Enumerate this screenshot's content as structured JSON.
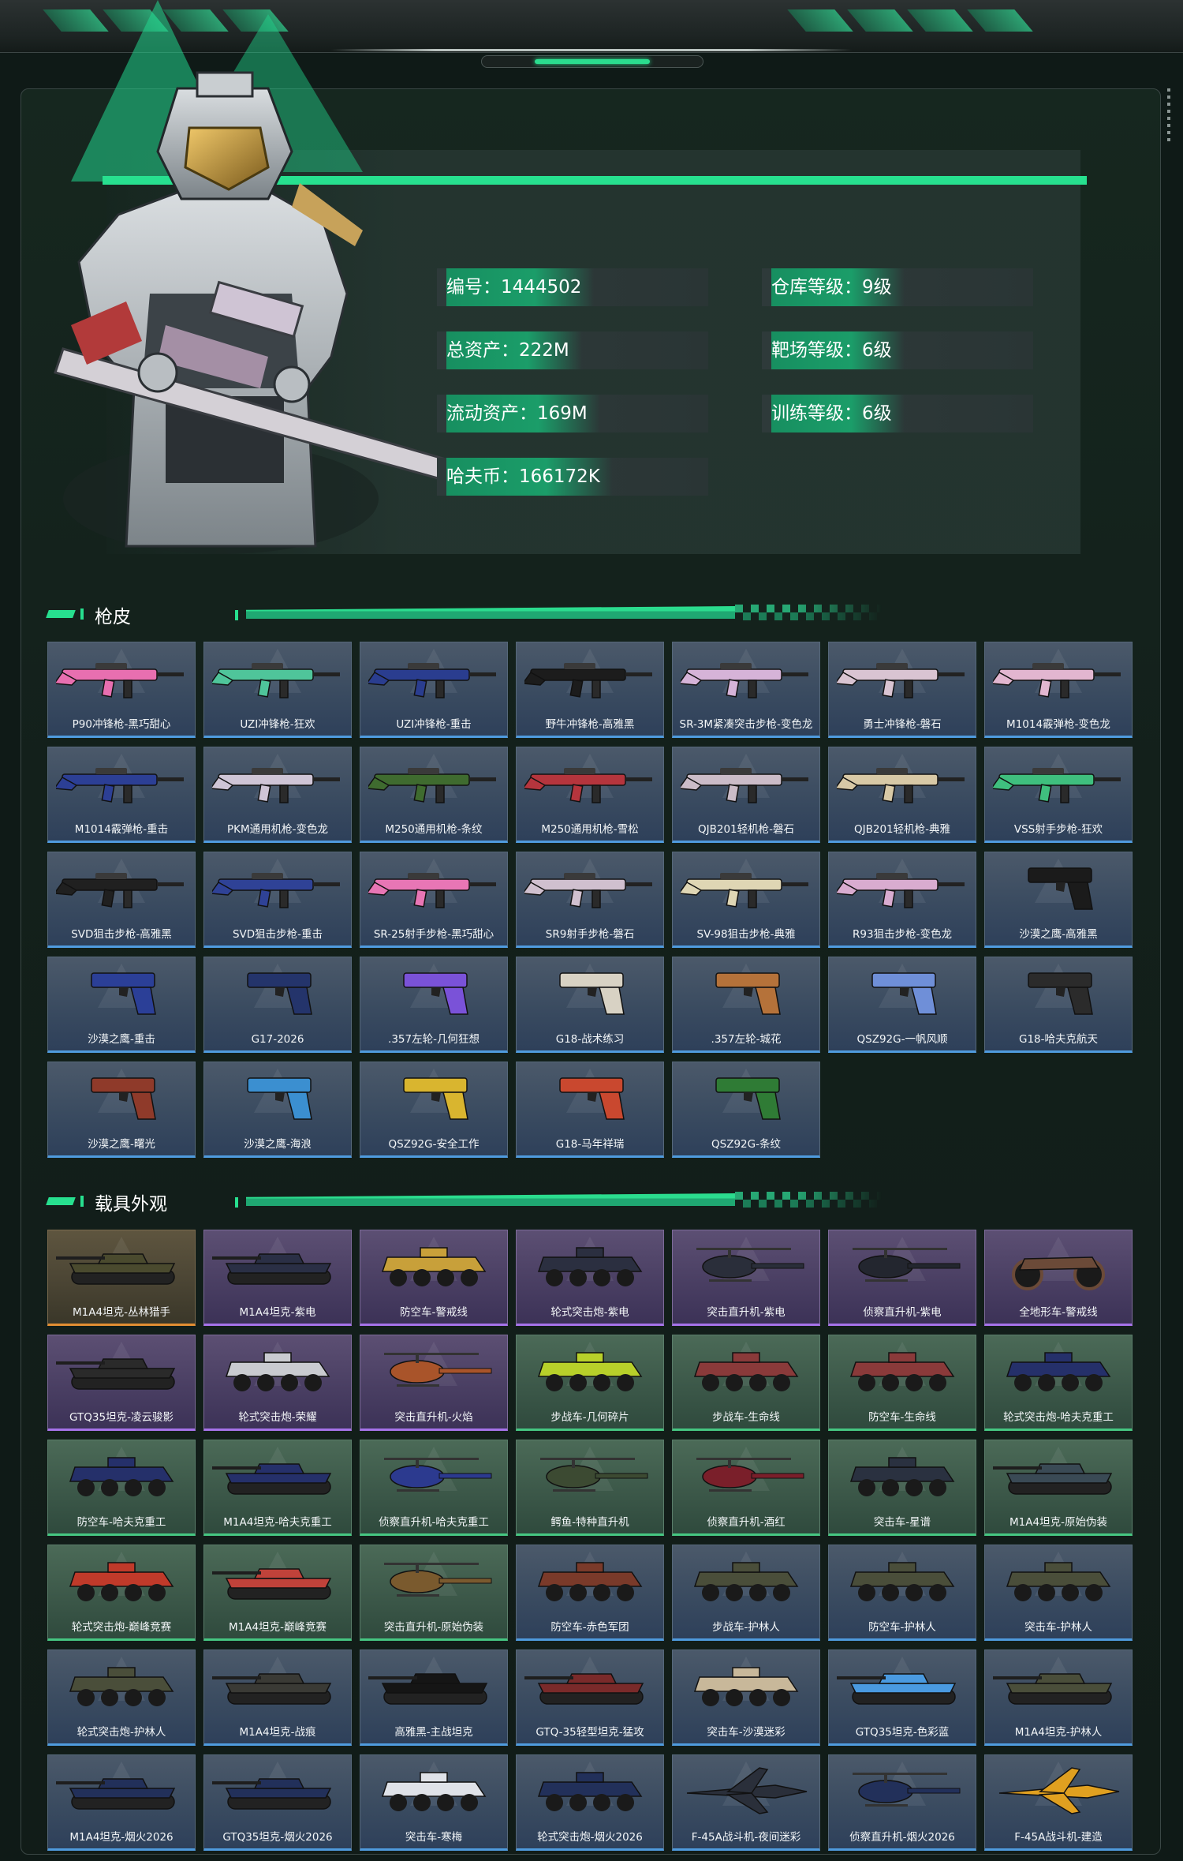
{
  "profile": {
    "stats": [
      {
        "label": "编号：",
        "value": "1444502"
      },
      {
        "label": "仓库等级：",
        "value": "9级"
      },
      {
        "label": "总资产：",
        "value": "222M"
      },
      {
        "label": "靶场等级：",
        "value": "6级"
      },
      {
        "label": "流动资产：",
        "value": "169M"
      },
      {
        "label": "训练等级：",
        "value": "6级"
      },
      {
        "label": "哈夫币：",
        "value": "166172K"
      }
    ]
  },
  "sections": {
    "gun_skins": {
      "title": "枪皮",
      "items": [
        {
          "name": "P90冲锋枪-黑巧甜心",
          "icon": "gun-icon",
          "color": "#e86fb0",
          "rarity": "blue"
        },
        {
          "name": "UZI冲锋枪-狂欢",
          "icon": "gun-icon",
          "color": "#4fc59a",
          "rarity": "blue"
        },
        {
          "name": "UZI冲锋枪-重击",
          "icon": "gun-icon",
          "color": "#2a3d8f",
          "rarity": "blue"
        },
        {
          "name": "野牛冲锋枪-高雅黑",
          "icon": "gun-icon",
          "color": "#1c1c1c",
          "rarity": "blue"
        },
        {
          "name": "SR-3M紧凑突击步枪-变色龙",
          "icon": "gun-icon",
          "color": "#d6b3d8",
          "rarity": "blue"
        },
        {
          "name": "勇士冲锋枪-磐石",
          "icon": "gun-icon",
          "color": "#d9c4d2",
          "rarity": "blue"
        },
        {
          "name": "M1014霰弹枪-变色龙",
          "icon": "gun-icon",
          "color": "#e2b6d0",
          "rarity": "blue"
        },
        {
          "name": "M1014霰弹枪-重击",
          "icon": "gun-icon",
          "color": "#2c3f95",
          "rarity": "blue"
        },
        {
          "name": "PKM通用机枪-变色龙",
          "icon": "gun-icon",
          "color": "#cfc5d6",
          "rarity": "blue"
        },
        {
          "name": "M250通用机枪-条纹",
          "icon": "gun-icon",
          "color": "#3f6b2f",
          "rarity": "blue"
        },
        {
          "name": "M250通用机枪-雪松",
          "icon": "gun-icon",
          "color": "#b5353d",
          "rarity": "blue"
        },
        {
          "name": "QJB201轻机枪-磐石",
          "icon": "gun-icon",
          "color": "#cbbcc8",
          "rarity": "blue"
        },
        {
          "name": "QJB201轻机枪-典雅",
          "icon": "gun-icon",
          "color": "#d8c9a6",
          "rarity": "blue"
        },
        {
          "name": "VSS射手步枪-狂欢",
          "icon": "gun-icon",
          "color": "#3fbf7e",
          "rarity": "blue"
        },
        {
          "name": "SVD狙击步枪-高雅黑",
          "icon": "gun-icon",
          "color": "#202020",
          "rarity": "blue"
        },
        {
          "name": "SVD狙击步枪-重击",
          "icon": "gun-icon",
          "color": "#2f4296",
          "rarity": "blue"
        },
        {
          "name": "SR-25射手步枪-黑巧甜心",
          "icon": "gun-icon",
          "color": "#e876b5",
          "rarity": "blue"
        },
        {
          "name": "SR9射手步枪-磐石",
          "icon": "gun-icon",
          "color": "#d0c0cf",
          "rarity": "blue"
        },
        {
          "name": "SV-98狙击步枪-典雅",
          "icon": "gun-icon",
          "color": "#dfd6b4",
          "rarity": "blue"
        },
        {
          "name": "R93狙击步枪-变色龙",
          "icon": "gun-icon",
          "color": "#d9acd0",
          "rarity": "blue"
        },
        {
          "name": "沙漠之鹰-高雅黑",
          "icon": "pistol-icon",
          "color": "#1b1b1b",
          "rarity": "blue"
        },
        {
          "name": "沙漠之鹰-重击",
          "icon": "pistol-icon",
          "color": "#2b3f97",
          "rarity": "blue"
        },
        {
          "name": "G17-2026",
          "icon": "pistol-icon",
          "color": "#24346b",
          "rarity": "blue"
        },
        {
          "name": ".357左轮-几何狂想",
          "icon": "pistol-icon",
          "color": "#7a52d8",
          "rarity": "blue"
        },
        {
          "name": "G18-战术练习",
          "icon": "pistol-icon",
          "color": "#d8d2c4",
          "rarity": "blue"
        },
        {
          "name": ".357左轮-城花",
          "icon": "pistol-icon",
          "color": "#b5723a",
          "rarity": "blue"
        },
        {
          "name": "QSZ92G-一帆风顺",
          "icon": "pistol-icon",
          "color": "#6f8fd8",
          "rarity": "blue"
        },
        {
          "name": "G18-哈夫克航天",
          "icon": "pistol-icon",
          "color": "#2b2b2b",
          "rarity": "blue"
        },
        {
          "name": "沙漠之鹰-曙光",
          "icon": "pistol-icon",
          "color": "#8f3a2a",
          "rarity": "blue"
        },
        {
          "name": "沙漠之鹰-海浪",
          "icon": "pistol-icon",
          "color": "#3b8fd0",
          "rarity": "blue"
        },
        {
          "name": "QSZ92G-安全工作",
          "icon": "pistol-icon",
          "color": "#d9b52f",
          "rarity": "blue"
        },
        {
          "name": "G18-马年祥瑞",
          "icon": "pistol-icon",
          "color": "#c9482f",
          "rarity": "blue"
        },
        {
          "name": "QSZ92G-条纹",
          "icon": "pistol-icon",
          "color": "#2f7b35",
          "rarity": "blue"
        }
      ]
    },
    "vehicle_skins": {
      "title": "载具外观",
      "items": [
        {
          "name": "M1A4坦克-丛林猎手",
          "icon": "tank-icon",
          "color": "#4a4a2e",
          "rarity": "orange"
        },
        {
          "name": "M1A4坦克-紫电",
          "icon": "tank-icon",
          "color": "#2a2f45",
          "rarity": "purple"
        },
        {
          "name": "防空车-警戒线",
          "icon": "apc-icon",
          "color": "#c8a03a",
          "rarity": "purple"
        },
        {
          "name": "轮式突击炮-紫电",
          "icon": "apc-icon",
          "color": "#2b2f40",
          "rarity": "purple"
        },
        {
          "name": "突击直升机-紫电",
          "icon": "helicopter-icon",
          "color": "#2a2e3a",
          "rarity": "purple"
        },
        {
          "name": "侦察直升机-紫电",
          "icon": "helicopter-icon",
          "color": "#23262f",
          "rarity": "purple"
        },
        {
          "name": "全地形车-警戒线",
          "icon": "atv-icon",
          "color": "#6b4a38",
          "rarity": "purple"
        },
        {
          "name": "GTQ35坦克-凌云骏影",
          "icon": "tank-icon",
          "color": "#2a2a2a",
          "rarity": "purple"
        },
        {
          "name": "轮式突击炮-荣耀",
          "icon": "apc-icon",
          "color": "#c9cbd0",
          "rarity": "purple"
        },
        {
          "name": "突击直升机-火焰",
          "icon": "helicopter-icon",
          "color": "#a9542a",
          "rarity": "purple"
        },
        {
          "name": "步战车-几何碎片",
          "icon": "apc-icon",
          "color": "#b8d02a",
          "rarity": "green"
        },
        {
          "name": "步战车-生命线",
          "icon": "apc-icon",
          "color": "#8a3a3a",
          "rarity": "green"
        },
        {
          "name": "防空车-生命线",
          "icon": "apc-icon",
          "color": "#8a3a3a",
          "rarity": "green"
        },
        {
          "name": "轮式突击炮-哈夫克重工",
          "icon": "apc-icon",
          "color": "#25306a",
          "rarity": "green"
        },
        {
          "name": "防空车-哈夫克重工",
          "icon": "apc-icon",
          "color": "#25306a",
          "rarity": "green"
        },
        {
          "name": "M1A4坦克-哈夫克重工",
          "icon": "tank-icon",
          "color": "#25306a",
          "rarity": "green"
        },
        {
          "name": "侦察直升机-哈夫克重工",
          "icon": "helicopter-icon",
          "color": "#2c3a8f",
          "rarity": "green"
        },
        {
          "name": "鳄鱼-特种直升机",
          "icon": "helicopter-icon",
          "color": "#3c4a32",
          "rarity": "green"
        },
        {
          "name": "侦察直升机-酒红",
          "icon": "helicopter-icon",
          "color": "#7a1f2a",
          "rarity": "green"
        },
        {
          "name": "突击车-星谱",
          "icon": "apc-icon",
          "color": "#2a3140",
          "rarity": "green"
        },
        {
          "name": "M1A4坦克-原始伪装",
          "icon": "tank-icon",
          "color": "#3a4a55",
          "rarity": "green"
        },
        {
          "name": "轮式突击炮-巅峰竞赛",
          "icon": "apc-icon",
          "color": "#c03a2a",
          "rarity": "green"
        },
        {
          "name": "M1A4坦克-巅峰竞赛",
          "icon": "tank-icon",
          "color": "#c0423a",
          "rarity": "green"
        },
        {
          "name": "突击直升机-原始伪装",
          "icon": "helicopter-icon",
          "color": "#7a5a2e",
          "rarity": "green"
        },
        {
          "name": "防空车-赤色军团",
          "icon": "apc-icon",
          "color": "#7a3a2a",
          "rarity": "blue"
        },
        {
          "name": "步战车-护林人",
          "icon": "apc-icon",
          "color": "#4a4e3a",
          "rarity": "blue"
        },
        {
          "name": "防空车-护林人",
          "icon": "apc-icon",
          "color": "#4a4e3a",
          "rarity": "blue"
        },
        {
          "name": "突击车-护林人",
          "icon": "apc-icon",
          "color": "#4a4e3a",
          "rarity": "blue"
        },
        {
          "name": "轮式突击炮-护林人",
          "icon": "apc-icon",
          "color": "#4a4e3a",
          "rarity": "blue"
        },
        {
          "name": "M1A4坦克-战痕",
          "icon": "tank-icon",
          "color": "#3a3a35",
          "rarity": "blue"
        },
        {
          "name": "高雅黑-主战坦克",
          "icon": "tank-icon",
          "color": "#151515",
          "rarity": "blue"
        },
        {
          "name": "GTQ-35轻型坦克-猛攻",
          "icon": "tank-icon",
          "color": "#7a2a2a",
          "rarity": "blue"
        },
        {
          "name": "突击车-沙漠迷彩",
          "icon": "apc-icon",
          "color": "#c8b89a",
          "rarity": "blue"
        },
        {
          "name": "GTQ35坦克-色彩蓝",
          "icon": "tank-icon",
          "color": "#4a9ae0",
          "rarity": "blue"
        },
        {
          "name": "M1A4坦克-护林人",
          "icon": "tank-icon",
          "color": "#4a4e3a",
          "rarity": "blue"
        },
        {
          "name": "M1A4坦克-烟火2026",
          "icon": "tank-icon",
          "color": "#22305a",
          "rarity": "blue"
        },
        {
          "name": "GTQ35坦克-烟火2026",
          "icon": "tank-icon",
          "color": "#22305a",
          "rarity": "blue"
        },
        {
          "name": "突击车-寒梅",
          "icon": "apc-icon",
          "color": "#dfe2e8",
          "rarity": "blue"
        },
        {
          "name": "轮式突击炮-烟火2026",
          "icon": "apc-icon",
          "color": "#22305a",
          "rarity": "blue"
        },
        {
          "name": "F-45A战斗机-夜间迷彩",
          "icon": "jet-icon",
          "color": "#2a2f3a",
          "rarity": "blue"
        },
        {
          "name": "侦察直升机-烟火2026",
          "icon": "helicopter-icon",
          "color": "#22305a",
          "rarity": "blue"
        },
        {
          "name": "F-45A战斗机-建造",
          "icon": "jet-icon",
          "color": "#e0a020",
          "rarity": "blue"
        }
      ]
    }
  },
  "colors": {
    "accent": "#27e08f",
    "blue_rarity": "#4f9bde",
    "purple_rarity": "#a673ea",
    "green_rarity": "#46c782",
    "orange_rarity": "#e28e33"
  }
}
